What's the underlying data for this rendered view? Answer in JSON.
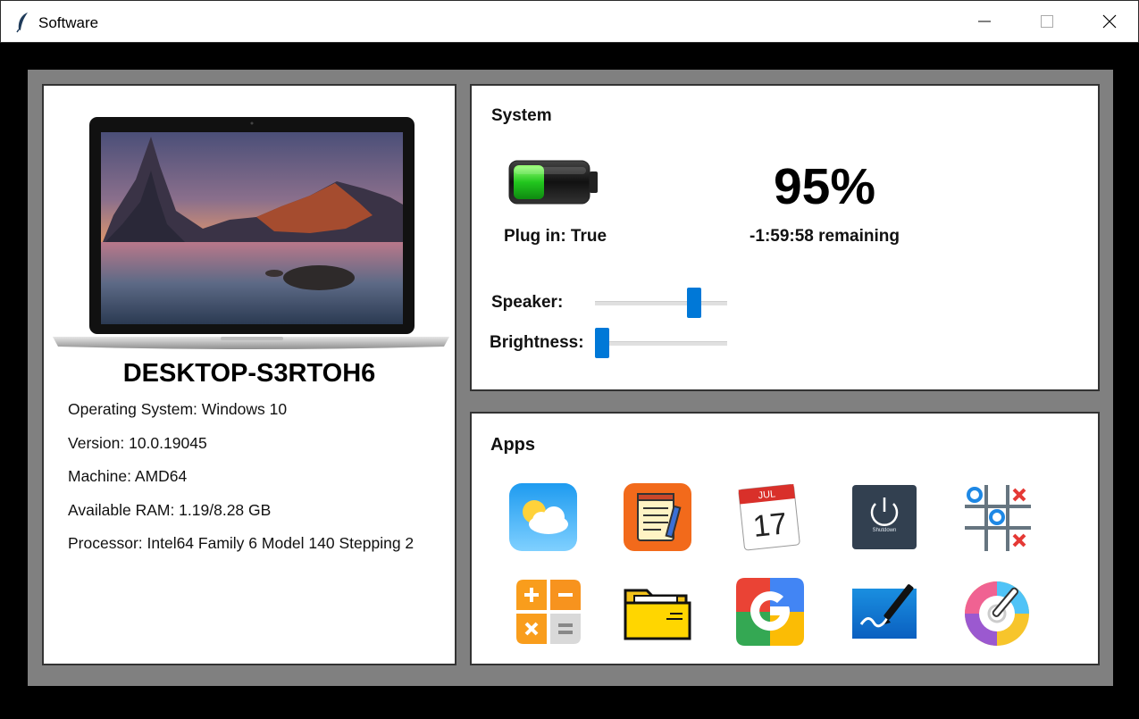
{
  "window": {
    "title": "Software"
  },
  "device": {
    "hostname": "DESKTOP-S3RTOH6",
    "info": [
      "Operating System: Windows 10",
      "Version: 10.0.19045",
      "Machine: AMD64",
      "Available RAM: 1.19/8.28 GB",
      "Processor: Intel64 Family 6 Model 140 Stepping 2"
    ]
  },
  "system": {
    "title": "System",
    "battery_percent_label": "95%",
    "plugged_label": "Plug in: True",
    "remaining_label": "-1:59:58 remaining",
    "speaker_label": "Speaker:",
    "speaker_level": 0.78,
    "brightness_label": "Brightness:",
    "brightness_level": 0.0
  },
  "apps": {
    "title": "Apps",
    "items": [
      "weather-icon",
      "notepad-icon",
      "calendar-icon",
      "shutdown-icon",
      "tic-tac-toe-icon",
      "calculator-icon",
      "folder-icon",
      "google-icon",
      "paint-icon",
      "color-picker-icon"
    ],
    "calendar_month": "JUL",
    "calendar_day": "17",
    "shutdown_text": "Shutdown"
  },
  "colors": {
    "accent": "#0078d7",
    "frame": "#808080"
  }
}
